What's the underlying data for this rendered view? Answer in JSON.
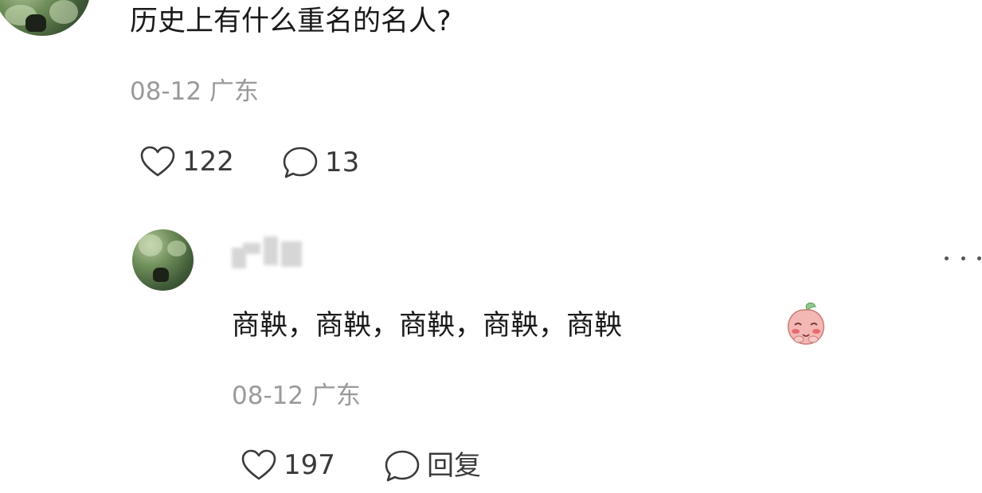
{
  "top_comment": {
    "text": "历史上有什么重名的名人?",
    "meta": "08-12 广东",
    "likes": "122",
    "replies": "13"
  },
  "reply": {
    "text": "商鞅，商鞅，商鞅，商鞅，商鞅",
    "emoji": "blushing-peach-emoji",
    "meta": "08-12 广东",
    "likes": "197",
    "reply_label": "回复"
  },
  "icons": {
    "like": "heart-outline-icon",
    "comment": "speech-bubble-icon",
    "more": "more-dots-icon"
  },
  "colors": {
    "text_primary": "#1a1a1a",
    "text_meta": "#9a9a9a",
    "icon": "#3a3a3a"
  }
}
